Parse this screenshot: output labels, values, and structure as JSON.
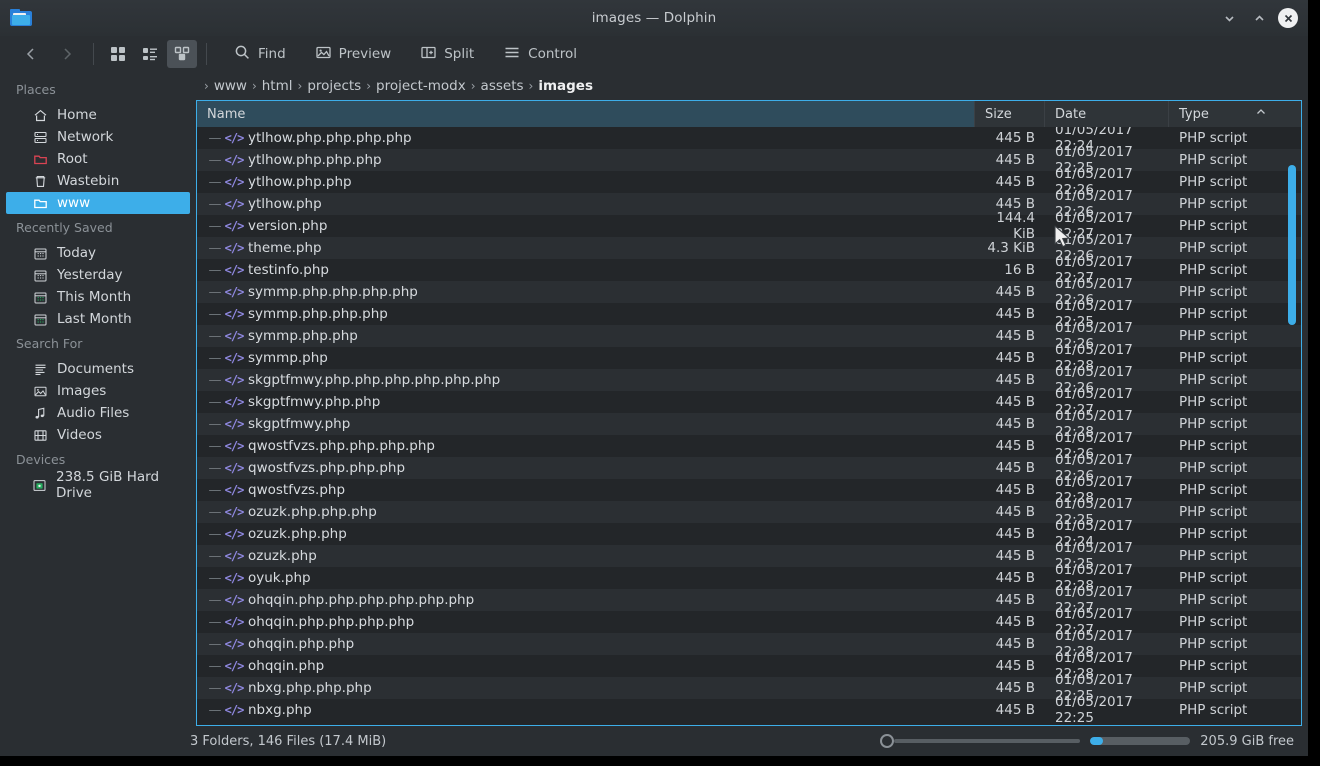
{
  "window": {
    "title": "images — Dolphin",
    "app_icon": "folder-icon",
    "buttons": {
      "minimize": "chevron-down-icon",
      "maximize": "chevron-up-icon",
      "close": "close-icon"
    }
  },
  "toolbar": {
    "back": "Back",
    "forward": "Forward",
    "view_icons": "Icons",
    "view_compact": "Compact",
    "view_details": "Details",
    "find": "Find",
    "preview": "Preview",
    "split": "Split",
    "control": "Control"
  },
  "sidebar": {
    "groups": [
      {
        "title": "Places",
        "items": [
          {
            "label": "Home",
            "icon": "home-icon",
            "selected": false
          },
          {
            "label": "Network",
            "icon": "network-icon",
            "selected": false
          },
          {
            "label": "Root",
            "icon": "folder-red-icon",
            "selected": false
          },
          {
            "label": "Wastebin",
            "icon": "trash-icon",
            "selected": false
          },
          {
            "label": "www",
            "icon": "folder-icon",
            "selected": true
          }
        ]
      },
      {
        "title": "Recently Saved",
        "items": [
          {
            "label": "Today",
            "icon": "calendar-icon",
            "selected": false
          },
          {
            "label": "Yesterday",
            "icon": "calendar-icon",
            "selected": false
          },
          {
            "label": "This Month",
            "icon": "calendar-green-icon",
            "selected": false
          },
          {
            "label": "Last Month",
            "icon": "calendar-green-icon",
            "selected": false
          }
        ]
      },
      {
        "title": "Search For",
        "items": [
          {
            "label": "Documents",
            "icon": "document-icon",
            "selected": false
          },
          {
            "label": "Images",
            "icon": "image-icon",
            "selected": false
          },
          {
            "label": "Audio Files",
            "icon": "music-note-icon",
            "selected": false
          },
          {
            "label": "Videos",
            "icon": "film-icon",
            "selected": false
          }
        ]
      },
      {
        "title": "Devices",
        "items": [
          {
            "label": "238.5 GiB Hard Drive",
            "icon": "hard-drive-icon",
            "selected": false
          }
        ]
      }
    ]
  },
  "breadcrumb": {
    "items": [
      "www",
      "html",
      "projects",
      "project-modx",
      "assets",
      "images"
    ],
    "current_index": 5,
    "separator": "›"
  },
  "columns": {
    "name": "Name",
    "size": "Size",
    "date": "Date",
    "type": "Type",
    "sort_column": "Type",
    "sort_direction": "ascending",
    "sort_arrow": "chevron-up-icon"
  },
  "files": [
    {
      "name": "ytlhow.php.php.php.php",
      "size": "445 B",
      "date": "01/05/2017 22:24",
      "type": "PHP script"
    },
    {
      "name": "ytlhow.php.php.php",
      "size": "445 B",
      "date": "01/05/2017 22:25",
      "type": "PHP script"
    },
    {
      "name": "ytlhow.php.php",
      "size": "445 B",
      "date": "01/05/2017 22:26",
      "type": "PHP script"
    },
    {
      "name": "ytlhow.php",
      "size": "445 B",
      "date": "01/05/2017 22:26",
      "type": "PHP script"
    },
    {
      "name": "version.php",
      "size": "144.4 KiB",
      "date": "01/05/2017 22:27",
      "type": "PHP script"
    },
    {
      "name": "theme.php",
      "size": "4.3 KiB",
      "date": "01/05/2017 22:26",
      "type": "PHP script"
    },
    {
      "name": "testinfo.php",
      "size": "16 B",
      "date": "01/05/2017 22:27",
      "type": "PHP script"
    },
    {
      "name": "symmp.php.php.php.php",
      "size": "445 B",
      "date": "01/05/2017 22:26",
      "type": "PHP script"
    },
    {
      "name": "symmp.php.php.php",
      "size": "445 B",
      "date": "01/05/2017 22:25",
      "type": "PHP script"
    },
    {
      "name": "symmp.php.php",
      "size": "445 B",
      "date": "01/05/2017 22:26",
      "type": "PHP script"
    },
    {
      "name": "symmp.php",
      "size": "445 B",
      "date": "01/05/2017 22:28",
      "type": "PHP script"
    },
    {
      "name": "skgptfmwy.php.php.php.php.php.php",
      "size": "445 B",
      "date": "01/05/2017 22:26",
      "type": "PHP script"
    },
    {
      "name": "skgptfmwy.php.php",
      "size": "445 B",
      "date": "01/05/2017 22:27",
      "type": "PHP script"
    },
    {
      "name": "skgptfmwy.php",
      "size": "445 B",
      "date": "01/05/2017 22:28",
      "type": "PHP script"
    },
    {
      "name": "qwostfvzs.php.php.php.php",
      "size": "445 B",
      "date": "01/05/2017 22:26",
      "type": "PHP script"
    },
    {
      "name": "qwostfvzs.php.php.php",
      "size": "445 B",
      "date": "01/05/2017 22:26",
      "type": "PHP script"
    },
    {
      "name": "qwostfvzs.php",
      "size": "445 B",
      "date": "01/05/2017 22:28",
      "type": "PHP script"
    },
    {
      "name": "ozuzk.php.php.php",
      "size": "445 B",
      "date": "01/05/2017 22:25",
      "type": "PHP script"
    },
    {
      "name": "ozuzk.php.php",
      "size": "445 B",
      "date": "01/05/2017 22:24",
      "type": "PHP script"
    },
    {
      "name": "ozuzk.php",
      "size": "445 B",
      "date": "01/05/2017 22:25",
      "type": "PHP script"
    },
    {
      "name": "oyuk.php",
      "size": "445 B",
      "date": "01/05/2017 22:28",
      "type": "PHP script"
    },
    {
      "name": "ohqqin.php.php.php.php.php.php",
      "size": "445 B",
      "date": "01/05/2017 22:27",
      "type": "PHP script"
    },
    {
      "name": "ohqqin.php.php.php.php",
      "size": "445 B",
      "date": "01/05/2017 22:27",
      "type": "PHP script"
    },
    {
      "name": "ohqqin.php.php",
      "size": "445 B",
      "date": "01/05/2017 22:28",
      "type": "PHP script"
    },
    {
      "name": "ohqqin.php",
      "size": "445 B",
      "date": "01/05/2017 22:28",
      "type": "PHP script"
    },
    {
      "name": "nbxg.php.php.php",
      "size": "445 B",
      "date": "01/05/2017 22:25",
      "type": "PHP script"
    },
    {
      "name": "nbxg.php",
      "size": "445 B",
      "date": "01/05/2017 22:25",
      "type": "PHP script"
    }
  ],
  "statusbar": {
    "summary": "3 Folders, 146 Files (17.4 MiB)",
    "free_space": "205.9 GiB free",
    "zoom_value": 0,
    "disk_used_percent": 13
  },
  "colors": {
    "accent": "#3daee9",
    "window_bg": "#2a2e32",
    "view_bg": "#232629",
    "row_alt": "#2b2f33",
    "text": "#d7dbdf",
    "php_icon": "#8f88e0",
    "root_icon": "#da4453"
  }
}
